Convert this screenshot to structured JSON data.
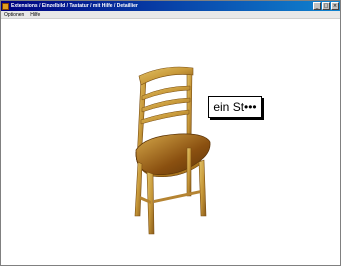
{
  "window": {
    "title": "Extensions / Einzelbild / Tastatur / mit Hilfe / Detaillier",
    "buttons": [
      "_",
      "□",
      "×"
    ]
  },
  "menu": {
    "items": [
      "Optionen",
      "Hilfe"
    ]
  },
  "scene": {
    "object": "chair",
    "bubble_text": "ein St•••"
  }
}
